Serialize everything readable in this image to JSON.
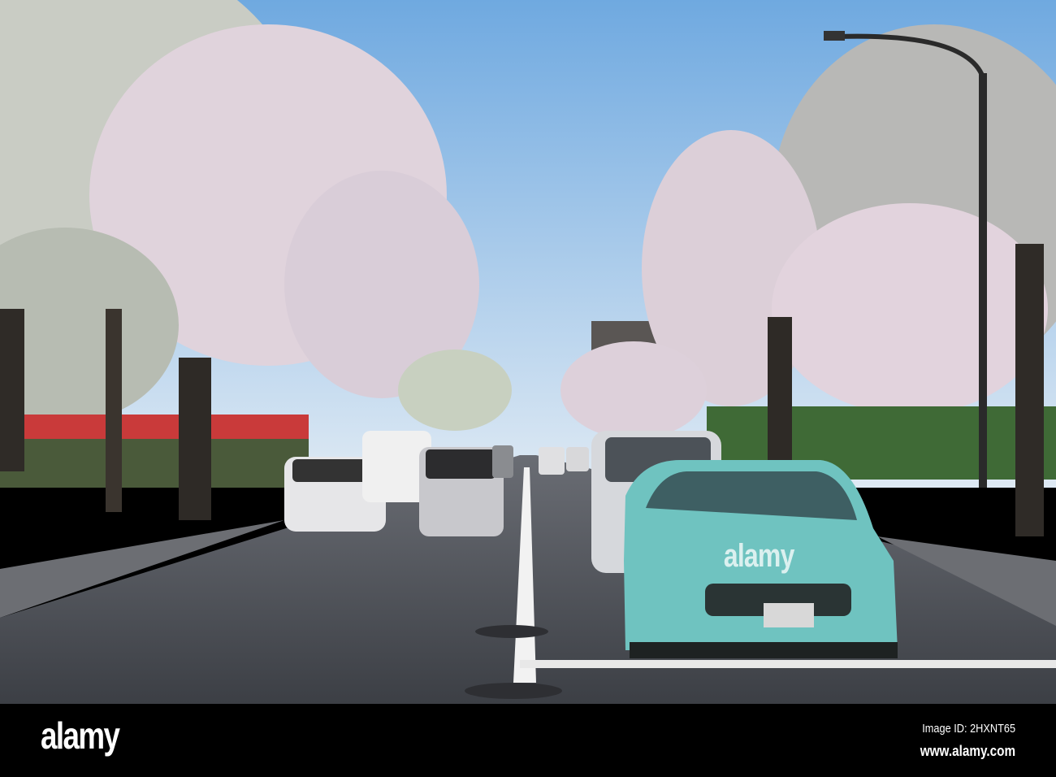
{
  "watermark": {
    "logo": "alamy",
    "center_text": "alamy"
  },
  "footer": {
    "image_id": "Image ID: 2HXNT65",
    "url": "www.alamy.com"
  },
  "colors": {
    "sky": "#8fc0ea",
    "blossom": "#e8d8e2",
    "road": "#4a4d53",
    "car": "#6fc3c0"
  }
}
